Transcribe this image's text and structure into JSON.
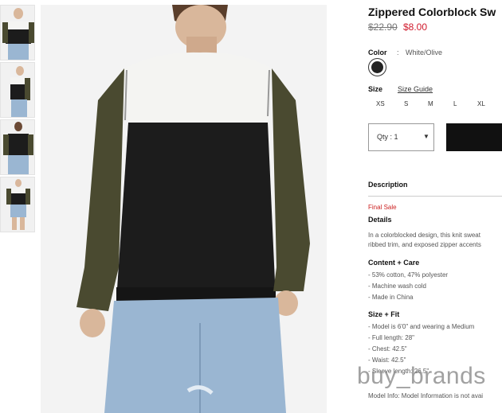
{
  "product": {
    "title": "Zippered Colorblock Sw",
    "price_original": "$22.90",
    "price_sale": "$8.00",
    "color_label": "Color",
    "color_separator": ":",
    "color_value": "White/Olive",
    "size_label": "Size",
    "size_guide": "Size Guide",
    "sizes": [
      "XS",
      "S",
      "M",
      "L",
      "XL"
    ],
    "qty_label": "Qty : 1"
  },
  "details": {
    "description_heading": "Description",
    "final_sale": "Final Sale",
    "details_heading": "Details",
    "details_lines": [
      "In a colorblocked design, this knit sweat",
      "ribbed trim, and exposed zipper accents"
    ],
    "content_heading": "Content + Care",
    "content_lines": [
      "- 53% cotton, 47% polyester",
      "- Machine wash cold",
      "- Made in China"
    ],
    "size_fit_heading": "Size + Fit",
    "size_fit_lines": [
      "- Model is 6'0\" and wearing a Medium",
      "- Full length: 28\"",
      "- Chest: 42.5\"",
      "- Waist: 42.5\"",
      "- Sleeve length: 26.5\""
    ],
    "model_info": "Model Info: Model Information is not avai"
  },
  "watermark": "buy_brands",
  "colors": {
    "sale_red": "#d0192b",
    "swatch": "#222222",
    "olive": "#4a4a30",
    "sweater_black": "#1c1c1c",
    "sweater_white": "#f4f4f2",
    "denim": "#9ab6d2"
  }
}
